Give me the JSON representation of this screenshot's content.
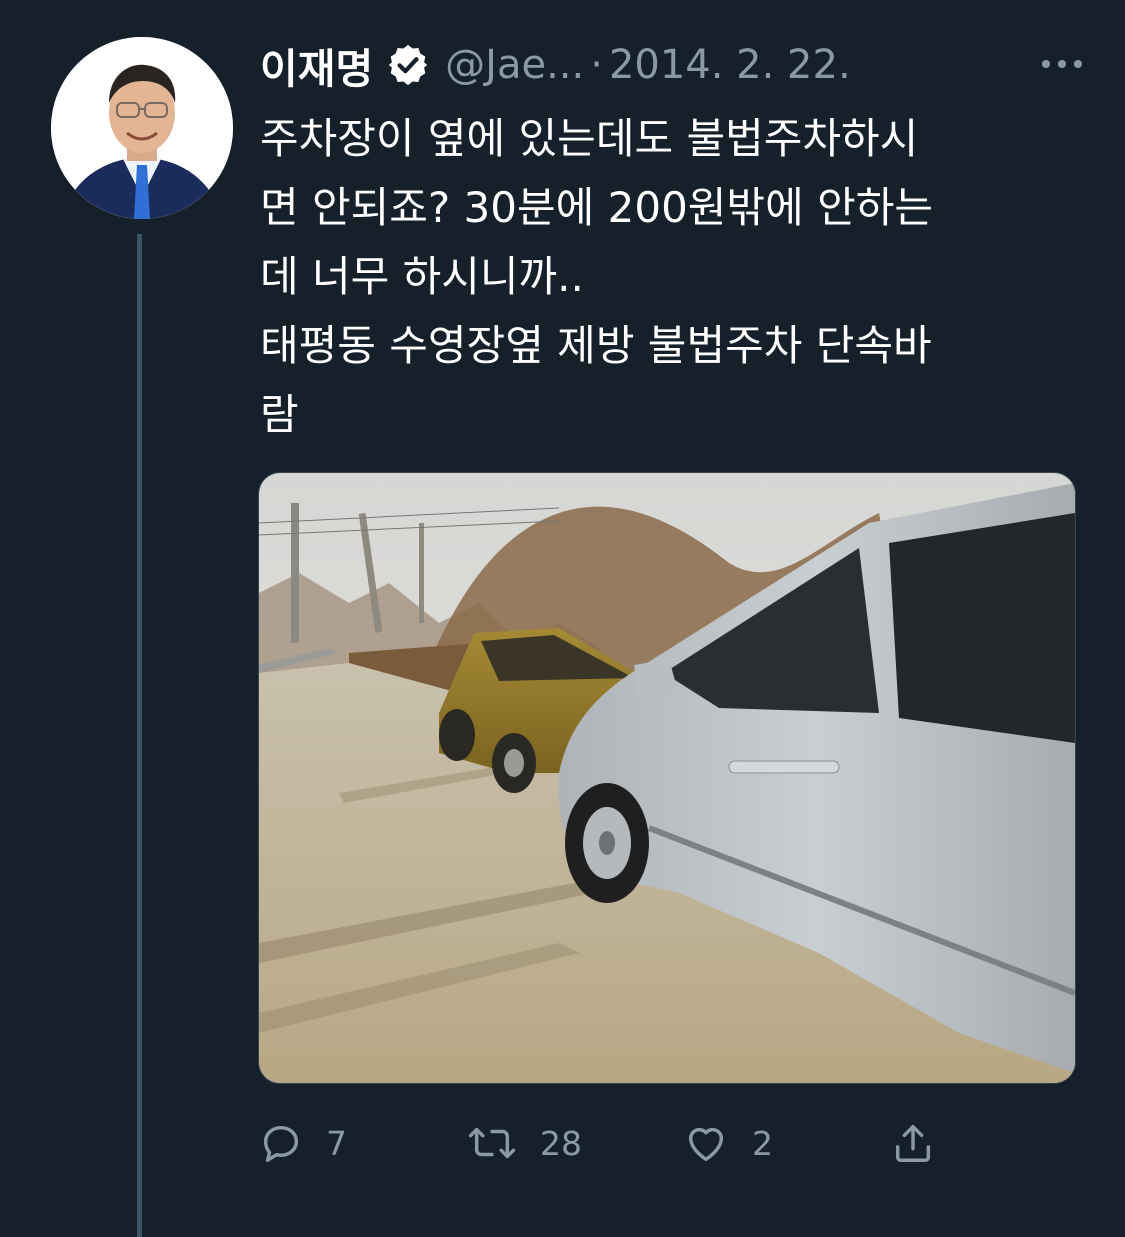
{
  "tweet": {
    "author_name": "이재명",
    "handle": "@Jae...",
    "separator": "·",
    "date": "2014. 2. 22.",
    "text": "주차장이 옆에 있는데도 불법주차하시\n면 안되죠? 30분에 200원밖에 안하는\n데 너무 하시니까..\n태평동 수영장옆 제방 불법주차 단속바\n람",
    "media_description": "photo",
    "actions": {
      "reply_count": "7",
      "retweet_count": "28",
      "like_count": "2"
    }
  },
  "icons": {
    "verified": "verified-badge-icon",
    "more": "more-options-icon",
    "reply": "reply-icon",
    "retweet": "retweet-icon",
    "like": "like-icon",
    "share": "share-icon"
  },
  "colors": {
    "background": "#15202b",
    "text_primary": "#ffffff",
    "text_secondary": "#8b98a5",
    "thread_line": "#3d5466",
    "media_border": "#38444d"
  }
}
